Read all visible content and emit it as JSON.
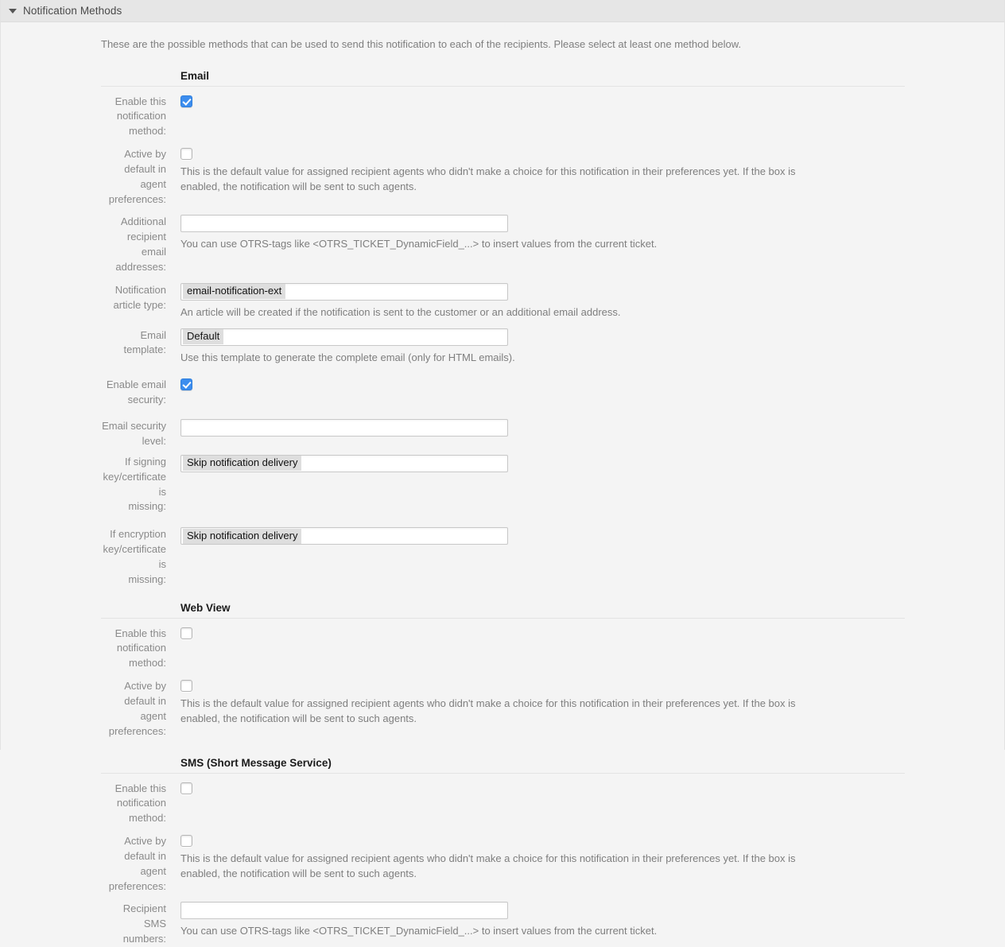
{
  "widget": {
    "title": "Notification Methods",
    "collapse_icon": "triangle-down-icon",
    "intro": "These are the possible methods that can be used to send this notification to each of the recipients. Please select at least one method below."
  },
  "common": {
    "enable_label": "Enable this notification method:",
    "active_default_label_line1": "Active by default in agent",
    "active_default_label_line2": "preferences:",
    "active_default_help": "This is the default value for assigned recipient agents who didn't make a choice for this notification in their preferences yet. If the box is enabled, the notification will be sent to such agents.",
    "otrs_tags_help": "You can use OTRS-tags like <OTRS_TICKET_DynamicField_...> to insert values from the current ticket.",
    "checkbox_on": "checked",
    "checkbox_off": "unchecked"
  },
  "sections": {
    "email": {
      "title": "Email",
      "enable_checked": true,
      "active_default_checked": false,
      "additional_recipient": {
        "label_line1": "Additional recipient email",
        "label_line2": "addresses:",
        "value": "",
        "placeholder": ""
      },
      "article_type": {
        "label": "Notification article type:",
        "selected": "email-notification-ext",
        "help": "An article will be created if the notification is sent to the customer or an additional email address."
      },
      "template": {
        "label": "Email template:",
        "selected": "Default",
        "help": "Use this template to generate the complete email (only for HTML emails)."
      },
      "security": {
        "enable_label": "Enable email security:",
        "enable_checked": true,
        "level_label": "Email security level:",
        "level_selected": "",
        "signing_label_line1": "If signing key/certificate is",
        "signing_label_line2": "missing:",
        "signing_selected": "Skip notification delivery",
        "encryption_label_line1": "If encryption key/certificate is",
        "encryption_label_line2": "missing:",
        "encryption_selected": "Skip notification delivery"
      }
    },
    "webview": {
      "title": "Web View",
      "enable_checked": false,
      "active_default_checked": false
    },
    "sms": {
      "title": "SMS (Short Message Service)",
      "enable_checked": false,
      "active_default_checked": false,
      "recipient_numbers": {
        "label": "Recipient SMS numbers:",
        "value": "",
        "placeholder": ""
      }
    }
  },
  "colors": {
    "accent": "#3c8dee",
    "header_bg": "#e6e6e6",
    "body_bg": "#f4f4f4",
    "label": "#8a8a8a",
    "help": "#7e7e7e",
    "chip_bg": "#dedede"
  }
}
